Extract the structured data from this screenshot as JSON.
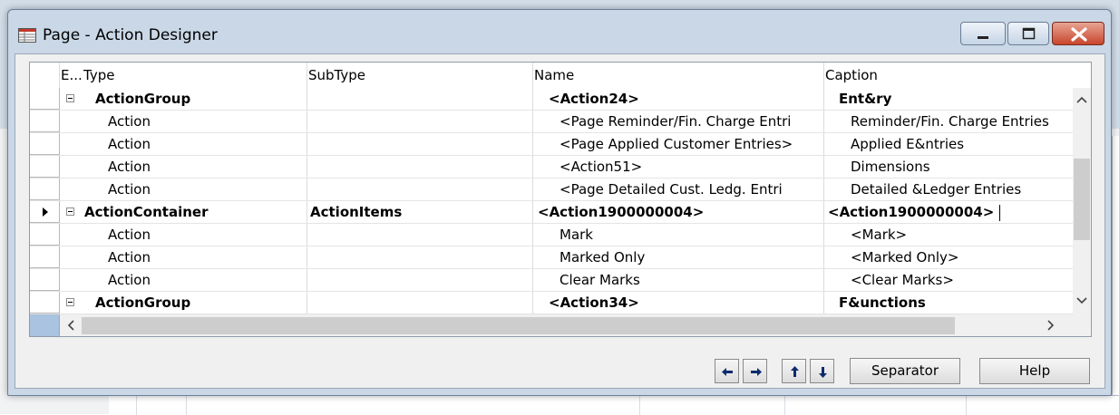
{
  "window": {
    "title": "Page - Action Designer"
  },
  "grid": {
    "columns": [
      "E...",
      "Type",
      "SubType",
      "Name",
      "Caption"
    ],
    "rows": [
      {
        "type": "ActionGroup",
        "subtype": "",
        "name": "<Action24>",
        "caption": "Ent&ry",
        "bold": true,
        "expandable": true,
        "indent": 1
      },
      {
        "type": "Action",
        "subtype": "",
        "name": "<Page Reminder/Fin. Charge Entri",
        "caption": "Reminder/Fin. Charge Entries",
        "bold": false,
        "expandable": false,
        "indent": 2
      },
      {
        "type": "Action",
        "subtype": "",
        "name": "<Page Applied Customer Entries>",
        "caption": "Applied E&ntries",
        "bold": false,
        "expandable": false,
        "indent": 2
      },
      {
        "type": "Action",
        "subtype": "",
        "name": "<Action51>",
        "caption": "Dimensions",
        "bold": false,
        "expandable": false,
        "indent": 2
      },
      {
        "type": "Action",
        "subtype": "",
        "name": "<Page Detailed Cust. Ledg. Entri",
        "caption": "Detailed &Ledger Entries",
        "bold": false,
        "expandable": false,
        "indent": 2
      },
      {
        "type": "ActionContainer",
        "subtype": "ActionItems",
        "name": "<Action1900000004>",
        "caption": "<Action1900000004>",
        "bold": true,
        "expandable": true,
        "indent": 0,
        "current": true
      },
      {
        "type": "Action",
        "subtype": "",
        "name": "Mark",
        "caption": "<Mark>",
        "bold": false,
        "expandable": false,
        "indent": 2
      },
      {
        "type": "Action",
        "subtype": "",
        "name": "Marked Only",
        "caption": "<Marked Only>",
        "bold": false,
        "expandable": false,
        "indent": 2
      },
      {
        "type": "Action",
        "subtype": "",
        "name": "Clear Marks",
        "caption": "<Clear Marks>",
        "bold": false,
        "expandable": false,
        "indent": 2
      },
      {
        "type": "ActionGroup",
        "subtype": "",
        "name": "<Action34>",
        "caption": "F&unctions",
        "bold": true,
        "expandable": true,
        "indent": 1
      }
    ]
  },
  "buttons": {
    "separator": "Separator",
    "help": "Help"
  },
  "icons": {
    "move_left": "arrow-left-icon",
    "move_right": "arrow-right-icon",
    "move_up": "arrow-up-icon",
    "move_down": "arrow-down-icon"
  },
  "colors": {
    "title_bar": "#c9d7e6",
    "close_button": "#c8452c",
    "selection_corner": "#a9c3e0"
  }
}
